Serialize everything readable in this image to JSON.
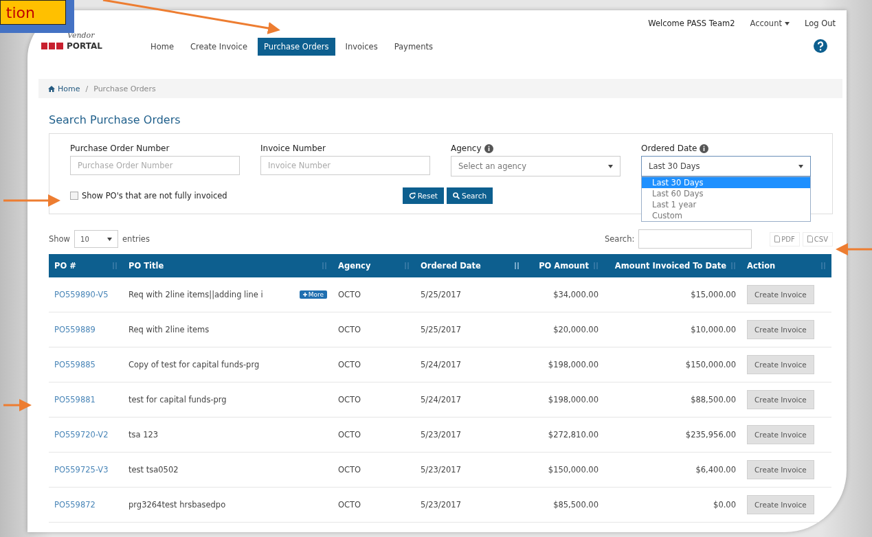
{
  "annotation": {
    "label": "tion"
  },
  "header": {
    "logo_script": "Vendor",
    "logo_text": "PORTAL",
    "nav": [
      {
        "label": "Home",
        "selected": false
      },
      {
        "label": "Create Invoice",
        "selected": false
      },
      {
        "label": "Purchase Orders",
        "selected": true
      },
      {
        "label": "Invoices",
        "selected": false
      },
      {
        "label": "Payments",
        "selected": false
      }
    ],
    "welcome": "Welcome PASS Team2",
    "account": "Account",
    "logout": "Log Out"
  },
  "breadcrumb": [
    "Home",
    "Purchase Orders"
  ],
  "breadcrumb_separator": "/",
  "page_title": "Search Purchase Orders",
  "filters": {
    "fields": [
      {
        "kind": "text",
        "label": "Purchase Order Number",
        "placeholder": "Purchase Order Number"
      },
      {
        "kind": "text",
        "label": "Invoice Number",
        "placeholder": "Invoice Number"
      },
      {
        "kind": "select",
        "label": "Agency",
        "placeholder": "Select an agency",
        "expanded": false
      },
      {
        "kind": "select",
        "label": "Ordered Date",
        "value": "Last 30 Days",
        "expanded": true,
        "options": [
          {
            "label": "Last 30 Days",
            "selected": true
          },
          {
            "label": "Last 60 Days",
            "selected": false
          },
          {
            "label": "Last 1 year",
            "selected": false
          },
          {
            "label": "Custom",
            "selected": false
          }
        ]
      }
    ],
    "checkbox": {
      "label": "Show PO's that are not fully invoiced",
      "checked": false
    },
    "buttons": [
      {
        "kind": "reset",
        "label": "Reset"
      },
      {
        "kind": "search",
        "label": "Search"
      }
    ]
  },
  "table_controls": {
    "show_label": "Show",
    "page_size": "10",
    "entries_label": "entries",
    "search_label": "Search:",
    "exports": [
      "PDF",
      "CSV"
    ]
  },
  "table": {
    "columns": [
      {
        "label": "PO #",
        "sorted": false
      },
      {
        "label": "PO Title",
        "sorted": false
      },
      {
        "label": "Agency",
        "sorted": false
      },
      {
        "label": "Ordered Date",
        "sorted": true
      },
      {
        "label": "PO Amount",
        "sorted": false
      },
      {
        "label": "Amount Invoiced To Date",
        "sorted": false
      },
      {
        "label": "Action",
        "sorted": false
      }
    ],
    "rows": [
      {
        "po": "PO559890-V5",
        "title": "Req with 2line items||adding line i",
        "more": "More",
        "agency": "OCTO",
        "date": "5/25/2017",
        "amount": "$34,000.00",
        "invoiced": "$15,000.00",
        "action": "Create Invoice"
      },
      {
        "po": "PO559889",
        "title": "Req with 2line items",
        "agency": "OCTO",
        "date": "5/25/2017",
        "amount": "$20,000.00",
        "invoiced": "$10,000.00",
        "action": "Create Invoice"
      },
      {
        "po": "PO559885",
        "title": "Copy of test for capital funds-prg",
        "agency": "OCTO",
        "date": "5/24/2017",
        "amount": "$198,000.00",
        "invoiced": "$150,000.00",
        "action": "Create Invoice"
      },
      {
        "po": "PO559881",
        "title": "test for capital funds-prg",
        "agency": "OCTO",
        "date": "5/24/2017",
        "amount": "$198,000.00",
        "invoiced": "$88,500.00",
        "action": "Create Invoice"
      },
      {
        "po": "PO559720-V2",
        "title": "tsa 123",
        "agency": "OCTO",
        "date": "5/23/2017",
        "amount": "$272,810.00",
        "invoiced": "$235,956.00",
        "action": "Create Invoice"
      },
      {
        "po": "PO559725-V3",
        "title": "test tsa0502",
        "agency": "OCTO",
        "date": "5/23/2017",
        "amount": "$150,000.00",
        "invoiced": "$6,400.00",
        "action": "Create Invoice"
      },
      {
        "po": "PO559872",
        "title": "prg3264test hrsbasedpo",
        "agency": "OCTO",
        "date": "5/23/2017",
        "amount": "$85,500.00",
        "invoiced": "$0.00",
        "action": "Create Invoice"
      }
    ]
  }
}
